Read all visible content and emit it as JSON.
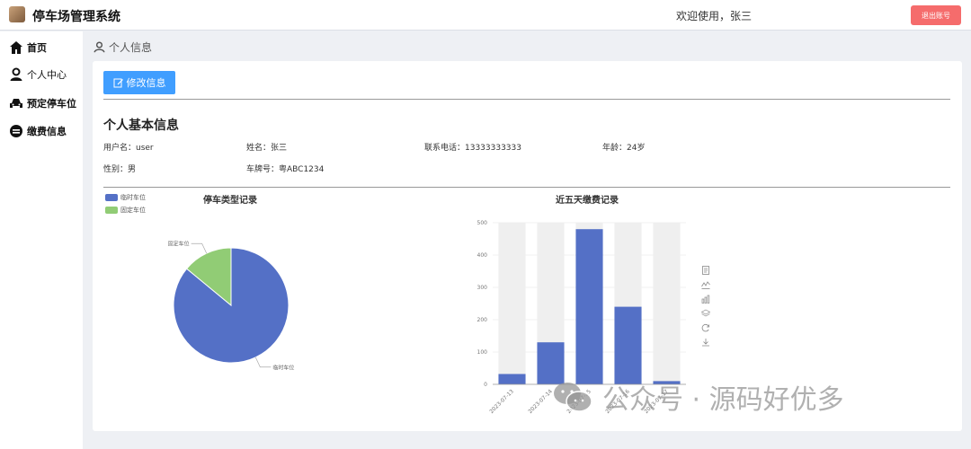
{
  "header": {
    "app_title": "停车场管理系统",
    "welcome": "欢迎使用，张三",
    "logout_label": "退出账号"
  },
  "sidebar": {
    "items": [
      {
        "label": "首页",
        "icon": "home-icon"
      },
      {
        "label": "个人中心",
        "icon": "user-icon"
      },
      {
        "label": "预定停车位",
        "icon": "car-icon"
      },
      {
        "label": "缴费信息",
        "icon": "payment-icon"
      }
    ]
  },
  "breadcrumb": {
    "label": "个人信息",
    "icon": "user-icon"
  },
  "profile": {
    "edit_label": "修改信息",
    "section_title": "个人基本信息",
    "fields": {
      "username": "用户名：user",
      "name": "姓名：张三",
      "phone": "联系电话：13333333333",
      "age": "年龄：24岁",
      "gender": "性别：男",
      "plate": "车牌号：粤ABC1234"
    }
  },
  "colors": {
    "primary": "#409eff",
    "danger": "#f56c6c",
    "series_blue": "#5470c6",
    "series_green": "#91cc75"
  },
  "chart_data": [
    {
      "type": "pie",
      "title": "停车类型记录",
      "legend_position": "top-left",
      "slices": [
        {
          "name": "临时车位",
          "value": 86
        },
        {
          "name": "固定车位",
          "value": 14
        }
      ]
    },
    {
      "type": "bar",
      "title": "近五天缴费记录",
      "categories": [
        "2023-07-13",
        "2023-07-14",
        "2023-07-15",
        "2023-07-16",
        "2023-07-17"
      ],
      "values": [
        32,
        130,
        480,
        240,
        10
      ],
      "ylim": [
        0,
        500
      ],
      "yticks": [
        0,
        100,
        200,
        300,
        400,
        500
      ],
      "grid": true,
      "background_bars": true
    }
  ],
  "watermark": "公众号 · 源码好优多"
}
